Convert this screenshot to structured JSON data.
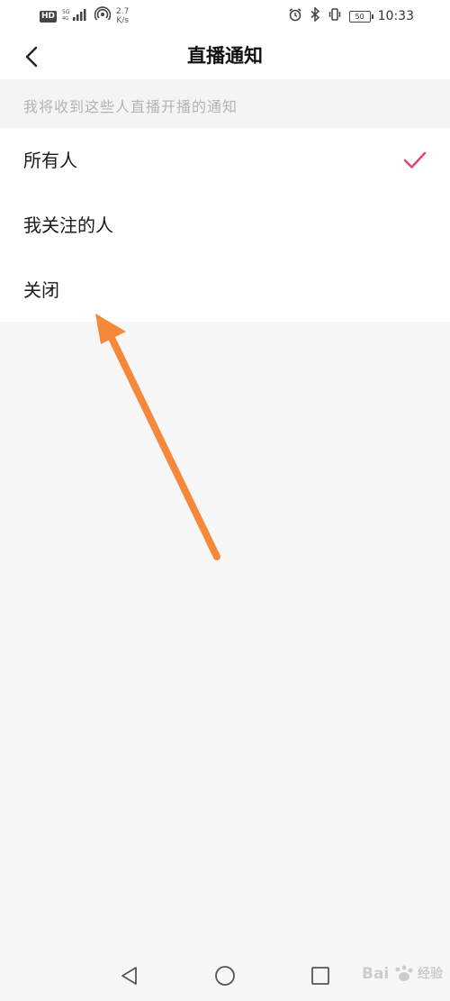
{
  "status_bar": {
    "hd": "HD",
    "network": "5G",
    "speed_value": "2.7",
    "speed_unit": "K/s",
    "battery": "50",
    "time": "10:33"
  },
  "header": {
    "title": "直播通知"
  },
  "section": {
    "hint": "我将收到这些人直播开播的通知"
  },
  "options": [
    {
      "label": "所有人",
      "selected": true
    },
    {
      "label": "我关注的人",
      "selected": false
    },
    {
      "label": "关闭",
      "selected": false
    }
  ],
  "colors": {
    "accent": "#e0457b",
    "annotation_arrow": "#f5883b"
  },
  "watermark": {
    "text": "经验"
  }
}
